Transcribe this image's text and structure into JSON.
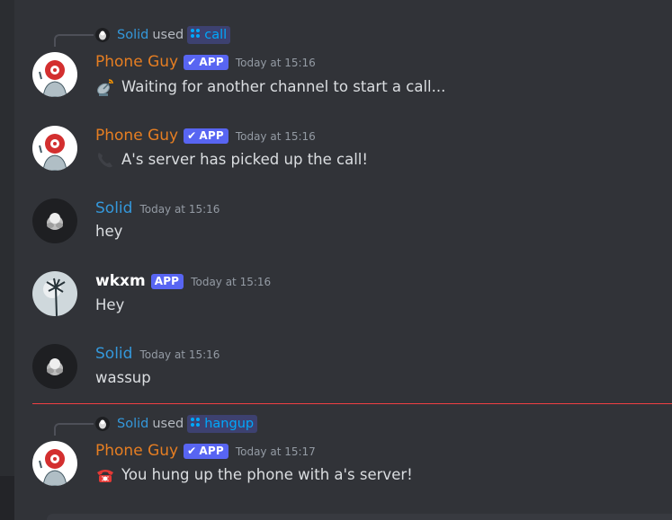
{
  "colors": {
    "background": "#313338",
    "phone_guy_name": "#e67e22",
    "solid_name": "#3498db",
    "wkxm_name": "#ffffff",
    "app_badge": "#5865f2",
    "new_messages_divider": "#f23f43",
    "timestamp": "#949ba4",
    "message_text": "#dbdee1"
  },
  "messages": [
    {
      "reply": {
        "user": "Solid",
        "used": "used",
        "command": "call",
        "command_icon": "slash-command-icon"
      },
      "author": "Phone Guy",
      "badge": "APP",
      "badge_check": "✔",
      "timestamp": "Today at 15:16",
      "emoji": "satellite-antenna-icon",
      "text": "Waiting for another channel to start a call..."
    },
    {
      "author": "Phone Guy",
      "badge": "APP",
      "badge_check": "✔",
      "timestamp": "Today at 15:16",
      "emoji": "telephone-receiver-icon",
      "text": "A's server has picked up the call!"
    },
    {
      "author": "Solid",
      "timestamp": "Today at 15:16",
      "text": "hey"
    },
    {
      "author": "wkxm",
      "badge": "APP",
      "timestamp": "Today at 15:16",
      "text": "Hey"
    },
    {
      "author": "Solid",
      "timestamp": "Today at 15:16",
      "text": "wassup"
    },
    {
      "reply": {
        "user": "Solid",
        "used": "used",
        "command": "hangup",
        "command_icon": "slash-command-icon"
      },
      "author": "Phone Guy",
      "badge": "APP",
      "badge_check": "✔",
      "timestamp": "Today at 15:17",
      "emoji": "telephone-icon",
      "text": "You hung up the phone with a's server!"
    }
  ]
}
